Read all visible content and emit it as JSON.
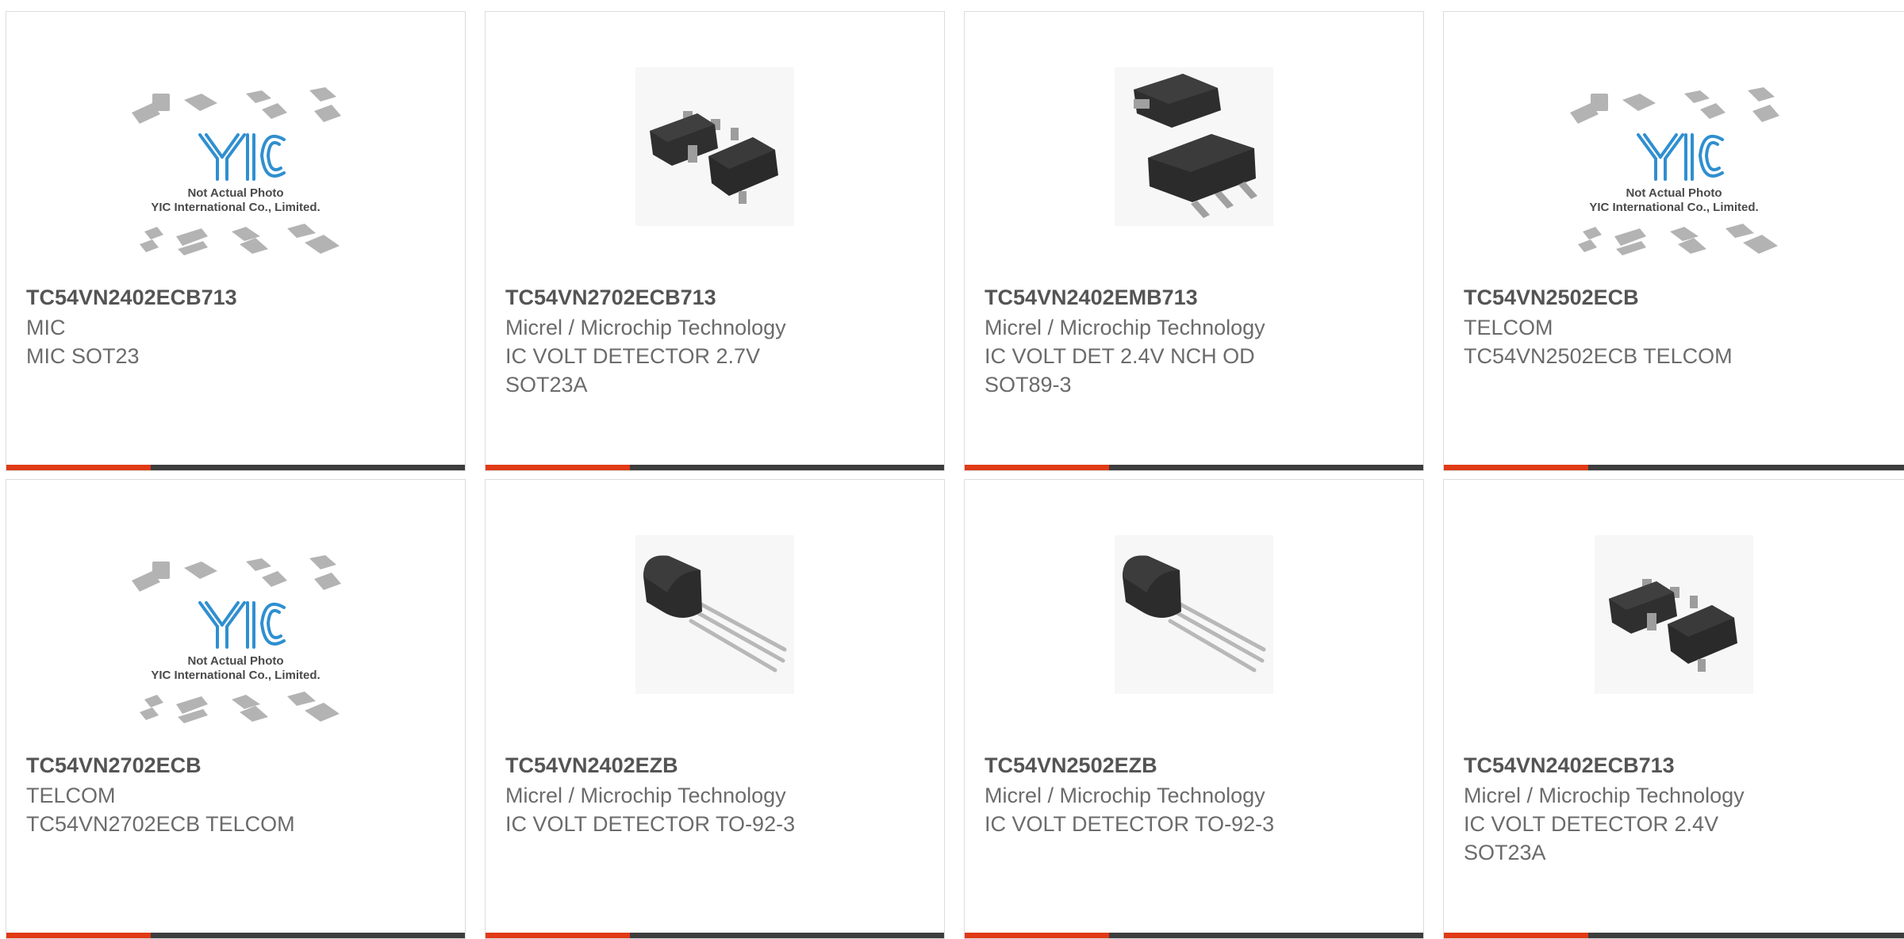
{
  "colors": {
    "accent": "#e03a16",
    "bar": "#3d3d3d",
    "border": "#dcdcdc",
    "text": "#6b6b6b",
    "title": "#545454",
    "logo_blue": "#2f8fd0"
  },
  "placeholder": {
    "brand": "YIC",
    "line1": "Not Actual Photo",
    "line2": "YIC International Co., Limited."
  },
  "products": [
    {
      "part": "TC54VN2402ECB713",
      "manufacturer": "MIC",
      "description": "MIC SOT23",
      "image_icon": "placeholder-logo-image"
    },
    {
      "part": "TC54VN2702ECB713",
      "manufacturer": "Micrel / Microchip Technology",
      "description": "IC VOLT DETECTOR 2.7V SOT23A",
      "image_icon": "sot23-package-image"
    },
    {
      "part": "TC54VN2402EMB713",
      "manufacturer": "Micrel / Microchip Technology",
      "description": "IC VOLT DET 2.4V NCH OD SOT89-3",
      "image_icon": "sot89-package-image"
    },
    {
      "part": "TC54VN2502ECB",
      "manufacturer": "TELCOM",
      "description": "TC54VN2502ECB TELCOM",
      "image_icon": "placeholder-logo-image"
    },
    {
      "part": "TC54VN2702ECB",
      "manufacturer": "TELCOM",
      "description": "TC54VN2702ECB TELCOM",
      "image_icon": "placeholder-logo-image"
    },
    {
      "part": "TC54VN2402EZB",
      "manufacturer": "Micrel / Microchip Technology",
      "description": "IC VOLT DETECTOR TO-92-3",
      "image_icon": "to92-package-image"
    },
    {
      "part": "TC54VN2502EZB",
      "manufacturer": "Micrel / Microchip Technology",
      "description": "IC VOLT DETECTOR TO-92-3",
      "image_icon": "to92-package-image"
    },
    {
      "part": "TC54VN2402ECB713",
      "manufacturer": "Micrel / Microchip Technology",
      "description": "IC VOLT DETECTOR 2.4V SOT23A",
      "image_icon": "sot23-package-image"
    }
  ]
}
